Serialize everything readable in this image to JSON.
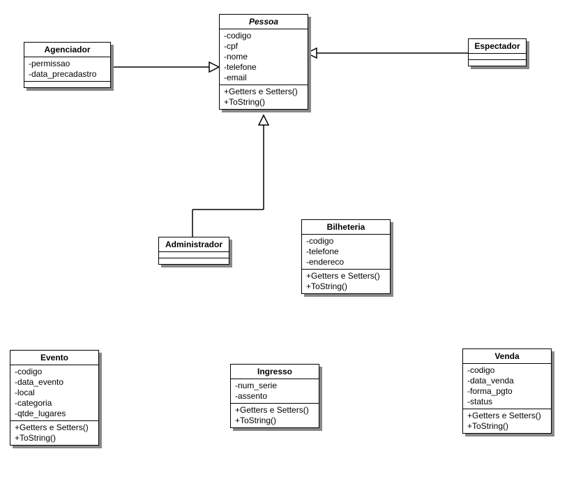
{
  "classes": {
    "agenciador": {
      "title": "Agenciador",
      "attrs": [
        "-permissao",
        "-data_precadastro"
      ],
      "ops": []
    },
    "pessoa": {
      "title": "Pessoa",
      "italic": true,
      "attrs": [
        "-codigo",
        "-cpf",
        "-nome",
        "-telefone",
        "-email"
      ],
      "ops": [
        "+Getters e Setters()",
        "+ToString()"
      ]
    },
    "espectador": {
      "title": "Espectador",
      "attrs": [],
      "ops": []
    },
    "administrador": {
      "title": "Administrador",
      "attrs": [],
      "ops": []
    },
    "bilheteria": {
      "title": "Bilheteria",
      "attrs": [
        "-codigo",
        "-telefone",
        "-endereco"
      ],
      "ops": [
        "+Getters e Setters()",
        "+ToString()"
      ]
    },
    "evento": {
      "title": "Evento",
      "attrs": [
        "-codigo",
        "-data_evento",
        "-local",
        "-categoria",
        "-qtde_lugares"
      ],
      "ops": [
        "+Getters e Setters()",
        "+ToString()"
      ]
    },
    "ingresso": {
      "title": "Ingresso",
      "attrs": [
        "-num_serie",
        "-assento"
      ],
      "ops": [
        "+Getters e Setters()",
        "+ToString()"
      ]
    },
    "venda": {
      "title": "Venda",
      "attrs": [
        "-codigo",
        "-data_venda",
        "-forma_pgto",
        "-status"
      ],
      "ops": [
        "+Getters e Setters()",
        "+ToString()"
      ]
    }
  }
}
